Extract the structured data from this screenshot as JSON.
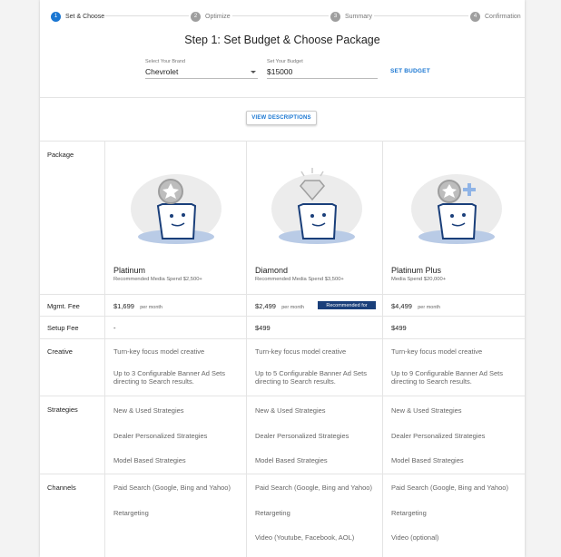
{
  "stepper": [
    {
      "num": "1",
      "label": "Set & Choose"
    },
    {
      "num": "2",
      "label": "Optimize"
    },
    {
      "num": "3",
      "label": "Summary"
    },
    {
      "num": "4",
      "label": "Confirmation"
    }
  ],
  "title": "Step 1: Set Budget & Choose Package",
  "brand": {
    "label": "Select Your Brand",
    "value": "Chevrolet"
  },
  "budget": {
    "label": "Set Your Budget",
    "value": "$15000"
  },
  "set_budget_label": "SET BUDGET",
  "view_descriptions_label": "VIEW DESCRIPTIONS",
  "row_labels": {
    "package": "Package",
    "mgmt_fee": "Mgmt. Fee",
    "setup_fee": "Setup Fee",
    "creative": "Creative",
    "strategies": "Strategies",
    "channels": "Channels"
  },
  "packages": [
    {
      "name": "Platinum",
      "recommended_spend": "Recommended Media Spend $2,500+",
      "mgmt_fee": "$1,699",
      "per_month": "per month",
      "setup_fee": "-",
      "creative": [
        "Turn-key focus model creative",
        "Up to 3 Configurable Banner Ad Sets directing to Search results."
      ],
      "strategies": [
        "New & Used Strategies",
        "Dealer Personalized Strategies",
        "Model Based Strategies"
      ],
      "channels": [
        "Paid Search (Google, Bing and Yahoo)",
        "Retargeting"
      ]
    },
    {
      "name": "Diamond",
      "recommended_spend": "Recommended Media Spend $3,500+",
      "mgmt_fee": "$2,499",
      "per_month": "per month",
      "badge": "Recommended for",
      "setup_fee": "$499",
      "creative": [
        "Turn-key focus model creative",
        "Up to 5 Configurable Banner Ad Sets directing to Search results."
      ],
      "strategies": [
        "New & Used Strategies",
        "Dealer Personalized Strategies",
        "Model Based Strategies"
      ],
      "channels": [
        "Paid Search (Google, Bing and Yahoo)",
        "Retargeting",
        "Video (Youtube, Facebook, AOL)"
      ]
    },
    {
      "name": "Platinum Plus",
      "recommended_spend": "Media Spend $20,000+",
      "mgmt_fee": "$4,499",
      "per_month": "per month",
      "setup_fee": "$499",
      "creative": [
        "Turn-key focus model creative",
        "Up to 9 Configurable Banner Ad Sets directing to Search results."
      ],
      "strategies": [
        "New & Used Strategies",
        "Dealer Personalized Strategies",
        "Model Based Strategies"
      ],
      "channels": [
        "Paid Search (Google, Bing and Yahoo)",
        "Retargeting",
        "Video (optional)"
      ]
    }
  ],
  "colors": {
    "accent": "#1976d2",
    "badge": "#1a3f7a",
    "inactive_step": "#9e9e9e"
  }
}
